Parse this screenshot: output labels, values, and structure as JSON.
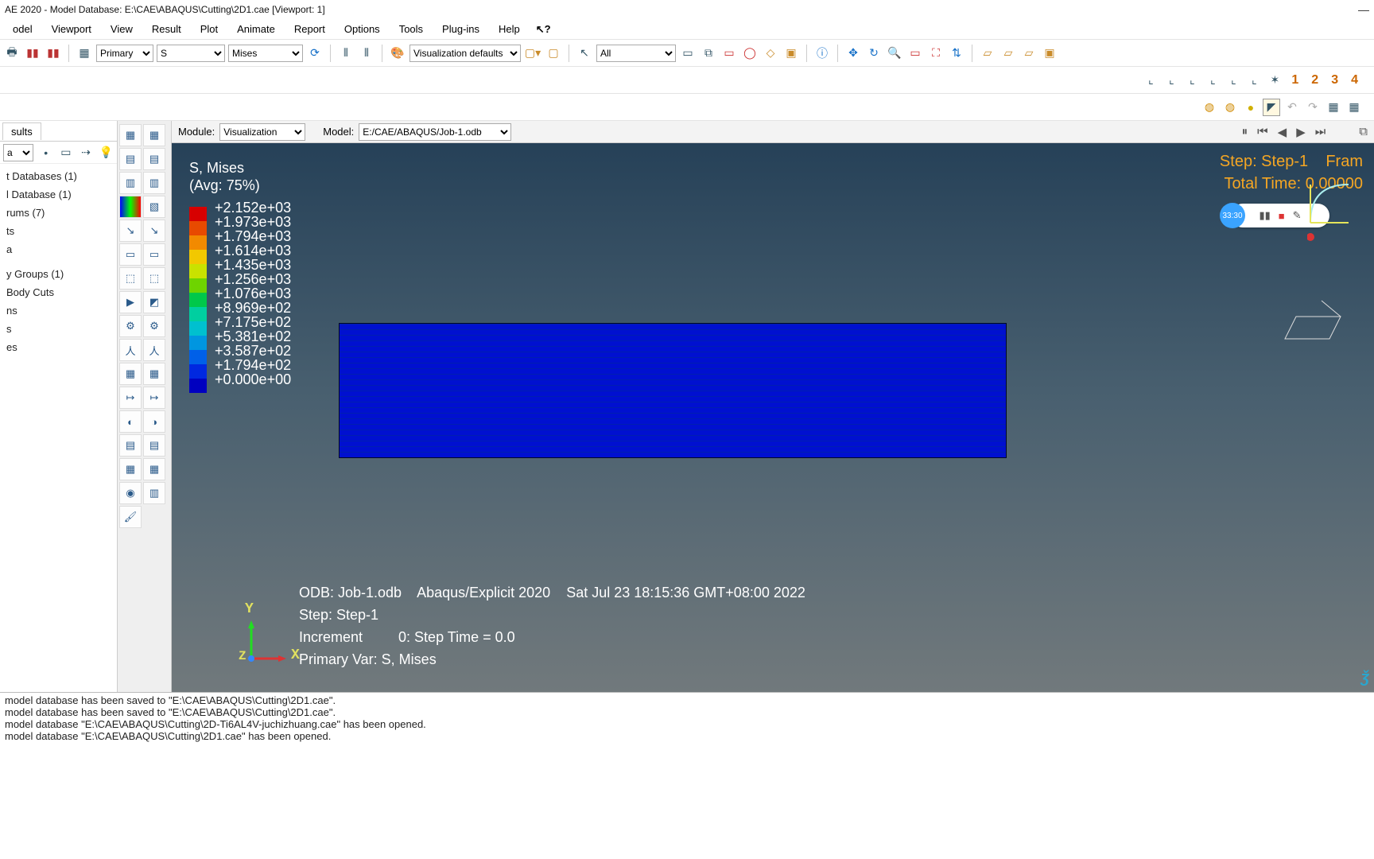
{
  "title": "AE 2020 - Model Database: E:\\CAE\\ABAQUS\\Cutting\\2D1.cae [Viewport: 1]",
  "menu": [
    "odel",
    "Viewport",
    "View",
    "Result",
    "Plot",
    "Animate",
    "Report",
    "Options",
    "Tools",
    "Plug-ins",
    "Help"
  ],
  "toolbar": {
    "primary": "Primary",
    "s": "S",
    "mises": "Mises",
    "visdef": "Visualization defaults",
    "all": "All",
    "nums": [
      "1",
      "2",
      "3",
      "4"
    ]
  },
  "module_label": "Module:",
  "module_value": "Visualization",
  "model_label": "Model:",
  "model_value": "E:/CAE/ABAQUS/Job-1.odb",
  "left_tab": "sults",
  "left_sel": "a",
  "tree": [
    "t Databases (1)",
    "l Database (1)",
    "rums (7)",
    "ts",
    "a",
    "",
    "y Groups (1)",
    "Body Cuts",
    "ns",
    "s",
    "es"
  ],
  "legend_title": "S, Mises",
  "legend_sub": "(Avg: 75%)",
  "legend_items": [
    {
      "c": "#d70000",
      "v": "+2.152e+03"
    },
    {
      "c": "#e84a00",
      "v": "+1.973e+03"
    },
    {
      "c": "#f28a00",
      "v": "+1.794e+03"
    },
    {
      "c": "#f2c800",
      "v": "+1.614e+03"
    },
    {
      "c": "#c9e200",
      "v": "+1.435e+03"
    },
    {
      "c": "#6ed400",
      "v": "+1.256e+03"
    },
    {
      "c": "#00c84a",
      "v": "+1.076e+03"
    },
    {
      "c": "#00cfa0",
      "v": "+8.969e+02"
    },
    {
      "c": "#00c0cf",
      "v": "+7.175e+02"
    },
    {
      "c": "#0096e0",
      "v": "+5.381e+02"
    },
    {
      "c": "#0060e8",
      "v": "+3.587e+02"
    },
    {
      "c": "#0028e0",
      "v": "+1.794e+02"
    },
    {
      "c": "#0000c0",
      "v": "+0.000e+00"
    }
  ],
  "step_banner_l1": "Step: Step-1    Fram",
  "step_banner_l2": "Total Time: 0.00000",
  "recorder_time": "33:30",
  "footer_l1": "ODB: Job-1.odb    Abaqus/Explicit 2020    Sat Jul 23 18:15:36 GMT+08:00 2022",
  "footer_l2": "Step: Step-1",
  "footer_l3": "Increment         0: Step Time = 0.0",
  "footer_l4": "Primary Var: S, Mises",
  "axis_y": "Y",
  "axis_x": "X",
  "axis_z": "Z",
  "console": [
    "model database has been saved to \"E:\\CAE\\ABAQUS\\Cutting\\2D1.cae\".",
    "model database has been saved to \"E:\\CAE\\ABAQUS\\Cutting\\2D1.cae\".",
    "model database \"E:\\CAE\\ABAQUS\\Cutting\\2D-Ti6AL4V-juchizhuang.cae\" has been opened.",
    "model database \"E:\\CAE\\ABAQUS\\Cutting\\2D1.cae\" has been opened."
  ]
}
